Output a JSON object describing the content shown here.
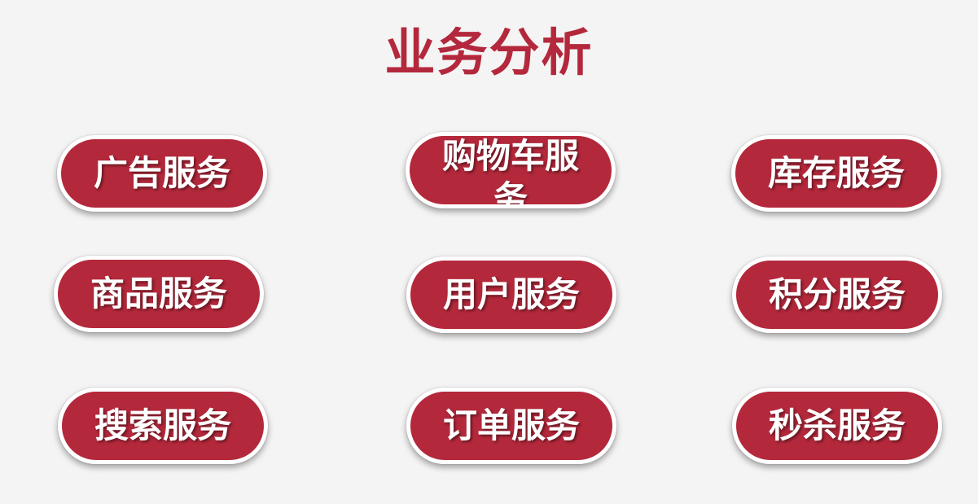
{
  "title": "业务分析",
  "services": [
    {
      "label": "广告服务"
    },
    {
      "label": "购物车服务"
    },
    {
      "label": "库存服务"
    },
    {
      "label": "商品服务"
    },
    {
      "label": "用户服务"
    },
    {
      "label": "积分服务"
    },
    {
      "label": "搜索服务"
    },
    {
      "label": "订单服务"
    },
    {
      "label": "秒杀服务"
    }
  ],
  "colors": {
    "background": "#f4f4f4",
    "accent": "#b4283b",
    "label": "#ffffff"
  }
}
